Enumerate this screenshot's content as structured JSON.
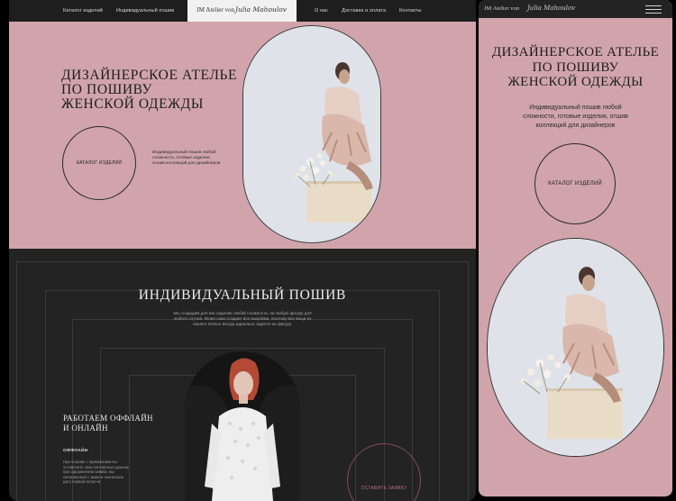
{
  "desktop": {
    "nav": {
      "catalog": "Каталог изделий",
      "individual": "Индивидуальный пошив",
      "about": "О нас",
      "delivery": "Доставка и оплата",
      "contacts": "Контакты"
    },
    "logo": {
      "text": "JM Atelier von",
      "signature": "Julia Mahoulov"
    },
    "hero": {
      "title_lines": [
        "ДИЗАЙНЕРСКОЕ АТЕЛЬЕ",
        "ПО ПОШИВУ",
        "ЖЕНСКОЙ ОДЕЖДЫ"
      ],
      "catalog_button": "КАТАЛОГ ИЗДЕЛИЙ",
      "description_lines": [
        "Индивидуальный пошив любой",
        "сложности, готовые изделия,",
        "отшив коллекций для дизайнеров"
      ]
    },
    "individual": {
      "title": "ИНДИВИДУАЛЬНЫЙ ПОШИВ",
      "description_lines": [
        "Мы создадим для вас изделие любой сложности, на любую фигуру для",
        "любого случая. Юлия сама создает все выкройки, поэтому все вещи из",
        "нашего ателье всегда идеально садятся на фигуру."
      ],
      "work_title_lines": [
        "РАБОТАЕМ ОФФЛАЙН",
        "И ОНЛАЙН"
      ],
      "offline_label": "ОФФЛАЙН",
      "offline_desc_lines": [
        "При пошиве с примерками вы",
        "оставляете свои контактные данные",
        "при оформлении заявки, мы",
        "связываемся с вами и назначаем",
        "дату первой встречи"
      ],
      "leave_request_button": "ОСТАВИТЬ ЗАЯВКУ"
    }
  },
  "mobile": {
    "logo": {
      "text": "JM Atelier von",
      "signature": "Julia Mahoulov"
    },
    "menu_icon": "hamburger-icon",
    "title_lines": [
      "ДИЗАЙНЕРСКОЕ АТЕЛЬЕ",
      "ПО ПОШИВУ",
      "ЖЕНСКОЙ ОДЕЖДЫ"
    ],
    "description_lines": [
      "Индивидуальный пошив любой",
      "сложности, готовые изделия, отшив",
      "коллекций для дизайнеров"
    ],
    "catalog_button": "КАТАЛОГ ИЗДЕЛИЙ"
  },
  "colors": {
    "pink": "#d1a4ac",
    "dark": "#232323",
    "accent": "#b96f82"
  }
}
